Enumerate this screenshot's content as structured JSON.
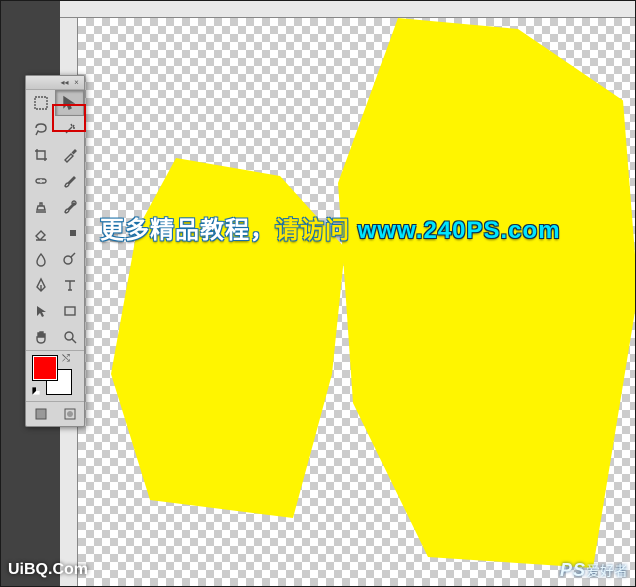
{
  "overlay": {
    "prefix": "更多精品教程，",
    "action": "请访问",
    "url": "www.240PS.com"
  },
  "tools": [
    {
      "name": "rectangular-marquee-tool",
      "selected": false,
      "icon": "marquee"
    },
    {
      "name": "move-tool",
      "selected": true,
      "icon": "move"
    },
    {
      "name": "lasso-tool",
      "selected": false,
      "icon": "lasso"
    },
    {
      "name": "magic-wand-tool",
      "selected": false,
      "icon": "wand"
    },
    {
      "name": "crop-tool",
      "selected": false,
      "icon": "crop"
    },
    {
      "name": "eyedropper-tool",
      "selected": false,
      "icon": "eyedropper"
    },
    {
      "name": "spot-healing-tool",
      "selected": false,
      "icon": "heal"
    },
    {
      "name": "brush-tool",
      "selected": false,
      "icon": "brush"
    },
    {
      "name": "clone-stamp-tool",
      "selected": false,
      "icon": "stamp"
    },
    {
      "name": "history-brush-tool",
      "selected": false,
      "icon": "history"
    },
    {
      "name": "eraser-tool",
      "selected": false,
      "icon": "eraser"
    },
    {
      "name": "gradient-tool",
      "selected": false,
      "icon": "gradient"
    },
    {
      "name": "blur-tool",
      "selected": false,
      "icon": "blur"
    },
    {
      "name": "dodge-tool",
      "selected": false,
      "icon": "dodge"
    },
    {
      "name": "pen-tool",
      "selected": false,
      "icon": "pen"
    },
    {
      "name": "type-tool",
      "selected": false,
      "icon": "type"
    },
    {
      "name": "path-selection-tool",
      "selected": false,
      "icon": "pathsel"
    },
    {
      "name": "shape-tool",
      "selected": false,
      "icon": "shape"
    },
    {
      "name": "hand-tool",
      "selected": false,
      "icon": "hand"
    },
    {
      "name": "zoom-tool",
      "selected": false,
      "icon": "zoom"
    }
  ],
  "colors": {
    "foreground": "#ff0000",
    "background": "#ffffff"
  },
  "watermarks": {
    "bottom_left": "UiBQ.Com",
    "bottom_right_big": "PS",
    "bottom_right_small": "爱好者"
  },
  "canvas": {
    "artwork_color": "#fff500",
    "artwork_description": "yellow-brush-calligraphy"
  }
}
